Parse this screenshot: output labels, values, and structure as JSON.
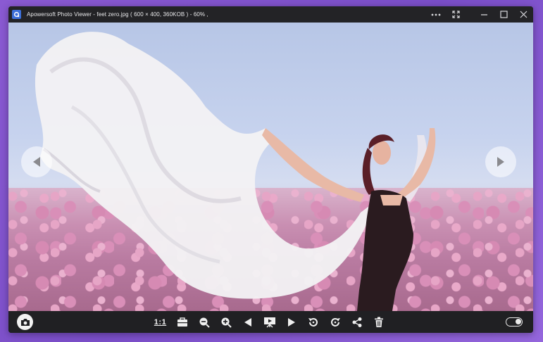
{
  "window": {
    "title": "Apowersoft Photo Viewer  - feet zero.jpg ( 600 × 400,  360KOB )  - 60% ,"
  },
  "titlebar_icons": [
    "more-icon",
    "fullscreen-icon",
    "minimize-icon",
    "maximize-icon",
    "close-icon"
  ],
  "toolbar": {
    "actual_size_label": "1:1",
    "icons": [
      "camera-icon",
      "toolbox-icon",
      "zoom-out-icon",
      "zoom-in-icon",
      "previous-icon",
      "slideshow-icon",
      "next-icon",
      "rotate-left-icon",
      "rotate-right-icon",
      "share-icon",
      "delete-icon",
      "toggle-icon"
    ]
  },
  "colors": {
    "titlebar_bg": "#232326",
    "toolbar_bg": "#202023",
    "desktop_bg": "#8a5ad2"
  }
}
